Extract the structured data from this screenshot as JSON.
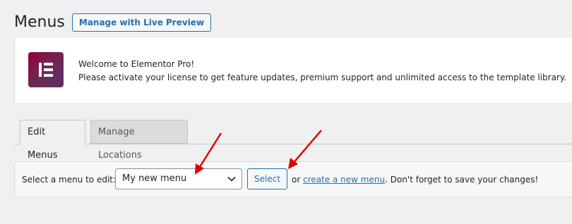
{
  "page": {
    "title": "Menus",
    "live_preview_label": "Manage with Live Preview"
  },
  "notice": {
    "title": "Welcome to Elementor Pro!",
    "body": "Please activate your license to get feature updates, premium support and unlimited access to the template library.",
    "logo_icon": "elementor-logo-icon",
    "logo_colors": [
      "#92003b",
      "#5a2f66"
    ]
  },
  "tabs": [
    {
      "label": "Edit Menus",
      "active": true
    },
    {
      "label": "Manage Locations",
      "active": false
    }
  ],
  "menu_select": {
    "label": "Select a menu to edit:",
    "selected": "My new menu",
    "button_label": "Select",
    "or_text": "or",
    "create_link": "create a new menu",
    "tail_text": ". Don't forget to save your changes!"
  },
  "colors": {
    "accent": "#2271b1",
    "annotation_arrow": "#e00000"
  }
}
